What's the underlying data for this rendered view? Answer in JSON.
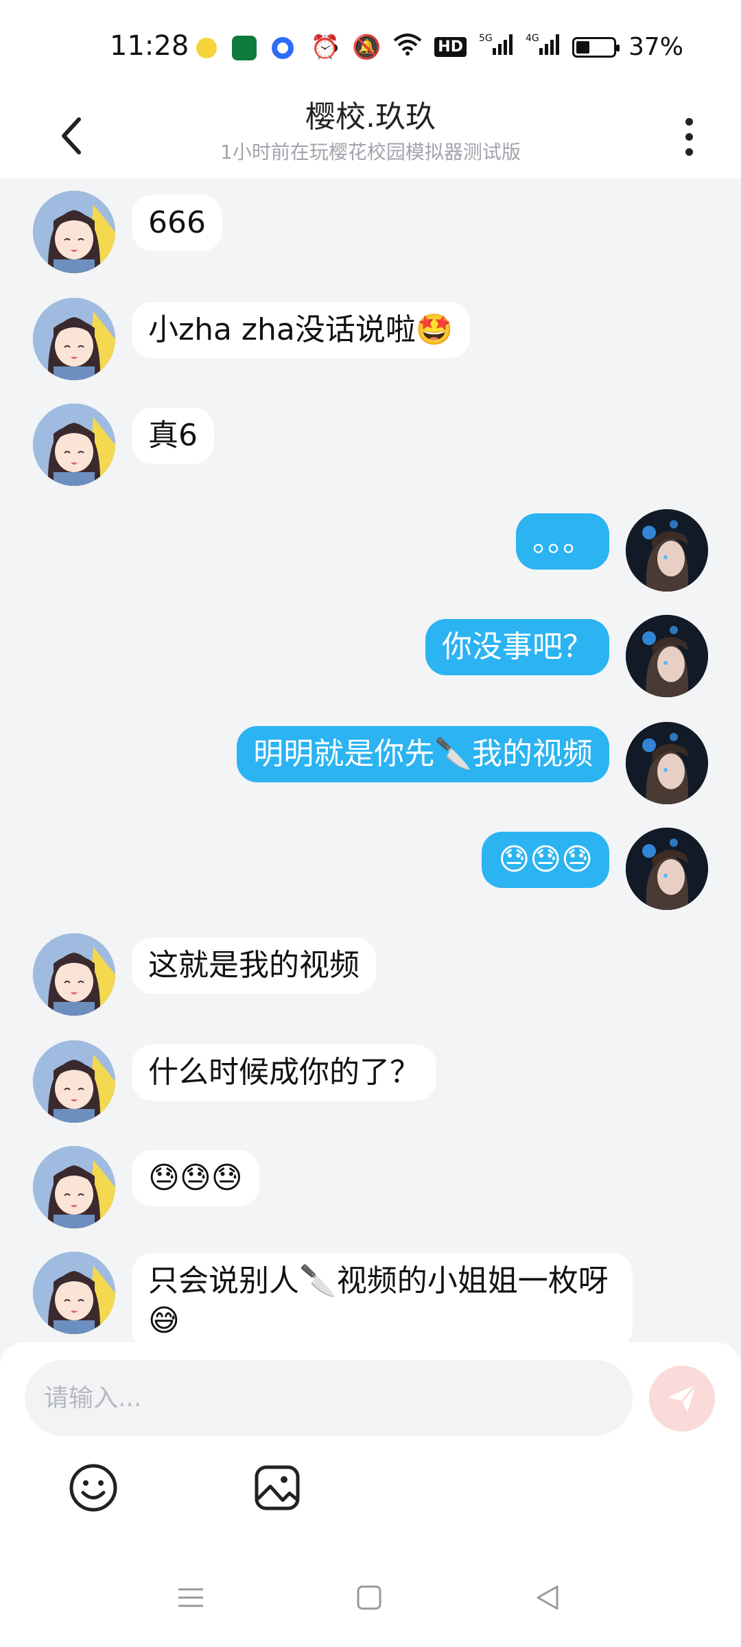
{
  "status_bar": {
    "time": "11:28",
    "battery_percent": "37%",
    "battery_level": 0.37,
    "icons": [
      "alarm-icon",
      "mute-icon",
      "wifi-icon",
      "hd-icon",
      "5g-signal-icon",
      "4g-signal-icon",
      "battery-icon"
    ]
  },
  "header": {
    "title": "樱校.玖玖",
    "subtitle": "1小时前在玩樱花校园模拟器测试版"
  },
  "messages": [
    {
      "side": "left",
      "text": "666"
    },
    {
      "side": "left",
      "text": "小zha zha没话说啦🤩"
    },
    {
      "side": "left",
      "text": "真6"
    },
    {
      "side": "right",
      "text": "。。。"
    },
    {
      "side": "right",
      "text": "你没事吧？"
    },
    {
      "side": "right",
      "text": "明明就是你先🔪我的视频"
    },
    {
      "side": "right",
      "text": "😓😓😓"
    },
    {
      "side": "left",
      "text": "这就是我的视频"
    },
    {
      "side": "left",
      "text": "什么时候成你的了？"
    },
    {
      "side": "left",
      "text": "😓😓😓"
    },
    {
      "side": "left",
      "text": "只会说别人🔪视频的小姐姐一枚呀😅"
    }
  ],
  "input": {
    "placeholder": "请输入..."
  },
  "colors": {
    "accent_blue": "#2bb3f2",
    "send_button_disabled": "#fbdada",
    "background": "#f3f4f6"
  }
}
